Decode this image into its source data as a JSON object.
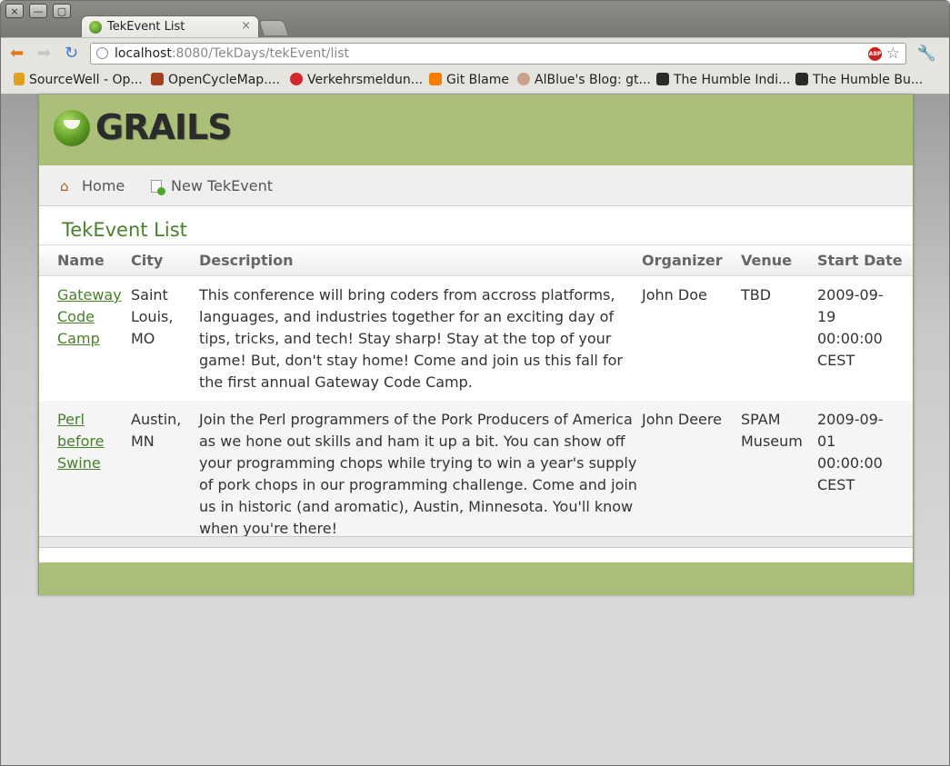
{
  "browser": {
    "tab_title": "TekEvent List",
    "tab_close": "×",
    "url_host": "localhost",
    "url_rest": ":8080/TekDays/tekEvent/list",
    "adblock_label": "ABP",
    "window_buttons": [
      "×",
      "—",
      "▢"
    ],
    "bookmarks": [
      {
        "label": "SourceWell - Op...",
        "icon": "sourcewell-icon",
        "color": "#e0a020"
      },
      {
        "label": "OpenCycleMap....",
        "icon": "opencyclemap-icon",
        "color": "#a0401c"
      },
      {
        "label": "Verkehrsmeldun...",
        "icon": "verkehrsmeldungen-icon",
        "color": "#d4262c"
      },
      {
        "label": "Git Blame",
        "icon": "blogger-icon",
        "color": "#f57d00"
      },
      {
        "label": "AlBlue's Blog: gt...",
        "icon": "alblue-icon",
        "color": "#c9a08a"
      },
      {
        "label": "The Humble Indi...",
        "icon": "humble-icon",
        "color": "#2a2a2a"
      },
      {
        "label": "The Humble Bu...",
        "icon": "humble-icon",
        "color": "#2a2a2a"
      }
    ]
  },
  "app": {
    "logo_text": "GRAILS",
    "nav": {
      "home": "Home",
      "new_event": "New TekEvent"
    },
    "page_title": "TekEvent List",
    "columns": [
      "Name",
      "City",
      "Description",
      "Organizer",
      "Venue",
      "Start Date"
    ],
    "rows": [
      {
        "name": "Gateway Code Camp",
        "city": "Saint Louis, MO",
        "description": "This conference will bring coders from accross platforms, languages, and industries together for an exciting day of tips, tricks, and tech! Stay sharp! Stay at the top of your game! But, don't stay home! Come and join us this fall for the first annual Gateway Code Camp.",
        "organizer": "John Doe",
        "venue": "TBD",
        "start_date": "2009-09-19 00:00:00 CEST"
      },
      {
        "name": "Perl before Swine",
        "city": "Austin, MN",
        "description": "Join the Perl programmers of the Pork Producers of America as we hone out skills and ham it up a bit. You can show off your programming chops while trying to win a year's supply of pork chops in our programming challenge. Come and join us in historic (and aromatic), Austin, Minnesota. You'll know when you're there!",
        "organizer": "John Deere",
        "venue": "SPAM Museum",
        "start_date": "2009-09-01 00:00:00 CEST"
      }
    ]
  },
  "colors": {
    "grails_green": "#abbf78",
    "link_green": "#48802c"
  }
}
